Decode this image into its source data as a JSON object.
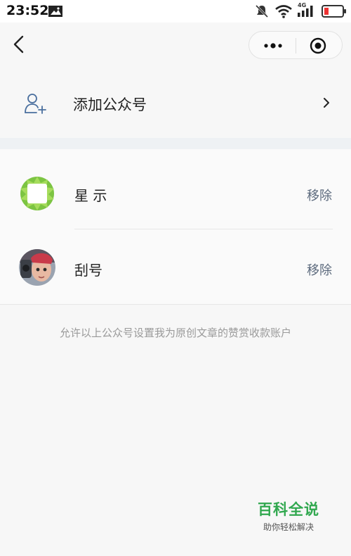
{
  "status_bar": {
    "time": "23:52",
    "network": "4G",
    "icons": [
      "image-icon",
      "mute-icon",
      "wifi-icon",
      "signal-icon",
      "battery-icon"
    ]
  },
  "nav": {
    "icons": [
      "back-icon",
      "more-icon",
      "target-icon"
    ]
  },
  "add_row": {
    "label": "添加公众号",
    "icon": "add-user-icon"
  },
  "accounts": [
    {
      "name": "星       示",
      "action": "移除",
      "avatar": "green-leaf-avatar"
    },
    {
      "name": "           刮号",
      "action": "移除",
      "avatar": "character-avatar"
    }
  ],
  "note": "允许以上公众号设置我为原创文章的赞赏收款账户",
  "watermark": {
    "title": "百科全说",
    "subtitle": "助你轻松解决"
  },
  "colors": {
    "background": "#f7f7f7",
    "link": "#5c6a7d",
    "watermark_green": "#31a84f"
  }
}
